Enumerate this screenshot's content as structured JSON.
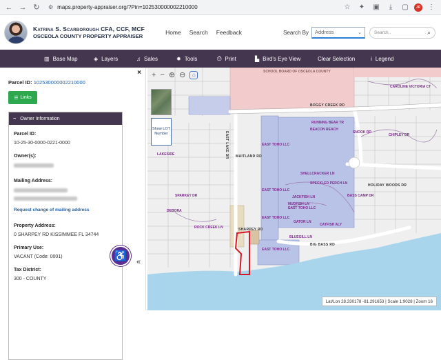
{
  "browser": {
    "url": "maps.property-appraiser.org/?Pin=102530000002210000",
    "profile_initials": "JR"
  },
  "header": {
    "owner_name": "Katrina S. Scarborough CFA, CCF, MCF",
    "office_name": "OSCEOLA COUNTY PROPERTY APPRAISER",
    "nav": [
      "Home",
      "Search",
      "Feedback"
    ],
    "search_by_label": "Search By",
    "search_by_value": "Address",
    "search_placeholder": "Search.."
  },
  "toolbar": {
    "items": [
      {
        "label": "Base Map",
        "icon": "book-icon"
      },
      {
        "label": "Layers",
        "icon": "layers-icon"
      },
      {
        "label": "Sales",
        "icon": "bell-icon"
      },
      {
        "label": "Tools",
        "icon": "gear-icon"
      },
      {
        "label": "Print",
        "icon": "printer-icon"
      },
      {
        "label": "Bird's Eye View",
        "icon": "building-icon"
      },
      {
        "label": "Clear Selection",
        "icon": ""
      },
      {
        "label": "Legend",
        "icon": "info-icon"
      }
    ]
  },
  "panel": {
    "parcel_label": "Parcel ID:",
    "parcel_id": "102530000002210000",
    "links_label": "Links",
    "card_title": "Owner Information",
    "parcel_field_label": "Parcel ID:",
    "parcel_field_value": "10-25-30-0000-0221-0000",
    "owners_label": "Owner(s):",
    "mailing_label": "Mailing Address:",
    "request_link": "Request change of mailing address",
    "property_label": "Property Address:",
    "property_value": "0 SHARPEY RD KISSIMMEE FL 34744",
    "use_label": "Primary Use:",
    "use_value": "VACANT (Code: 0001)",
    "tax_label": "Tax District:",
    "tax_value": "300 - COUNTY"
  },
  "map": {
    "lot_button": "Show LOT Number",
    "status": "Lat/Lon 28.330178 -81.291653 | Scale 1:9028 | Zoom 16",
    "school_label": "SCHOOL BOARD OF OSCEOLA COUNTY",
    "roads": [
      "BOGGY CREEK RD",
      "EAST LAKE DR",
      "MAITLAND RD",
      "HOLIDAY WOODS DR",
      "BIG BASS RD",
      "SHARPEY RD"
    ],
    "labels": [
      "CAROLINE VICTORIA CT",
      "RUNNING BEAR TR",
      "BEACON REACH",
      "SHELLCRACKER LN",
      "SPECKLED PERCH LN",
      "JACKFISH LN",
      "BLUEGILL LN",
      "MUDFISH LN",
      "EAST TOHO LLC",
      "EAST TOHO LLC",
      "EAST TOHO LLC",
      "EAST TOHO LLC",
      "EAST TOHO LLC",
      "ROCK CREEK LN",
      "DEBORA",
      "SPARKEY DR",
      "LAKESIDE",
      "GATOR LN",
      "CATFISH ALY",
      "BASS CAMP DR",
      "SNOOK RD",
      "CHIPLEY DR"
    ]
  },
  "colors": {
    "toolbar_bg": "#453650",
    "links_green": "#2ea84f",
    "water": "#a8d5ec",
    "parcel_blue": "#b9c3e8",
    "parcel_pink": "#f2cccc",
    "selected_outline": "#d8182a",
    "accessibility_purple": "#5b2d8e"
  }
}
